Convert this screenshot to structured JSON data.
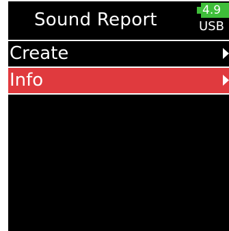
{
  "header": {
    "title": "Sound Report",
    "battery_level": "4.9",
    "battery_color": "#3fbe3a",
    "power_source": "USB"
  },
  "menu": {
    "items": [
      {
        "label": "Create",
        "selected": false,
        "icon": "chevron-right-icon"
      },
      {
        "label": "Info",
        "selected": true,
        "icon": "chevron-right-icon"
      }
    ]
  },
  "colors": {
    "background": "#000000",
    "selection": "#e03a3e",
    "text": "#ffffff"
  }
}
